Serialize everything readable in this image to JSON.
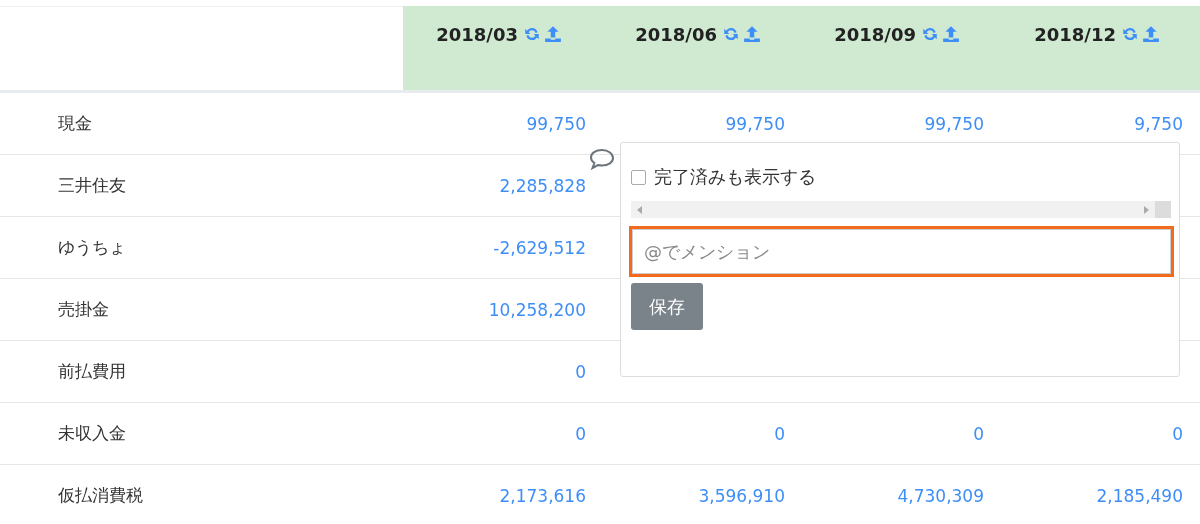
{
  "table": {
    "columns": [
      {
        "label": "2018/03"
      },
      {
        "label": "2018/06"
      },
      {
        "label": "2018/09"
      },
      {
        "label": "2018/12"
      }
    ],
    "rows": [
      {
        "label": "現金",
        "column_1": "99,750",
        "column_2": "99,750",
        "column_3": "99,750",
        "column_4": "9,750"
      },
      {
        "label": "三井住友",
        "column_1": "2,285,828"
      },
      {
        "label": "ゆうちょ",
        "column_1": "-2,629,512"
      },
      {
        "label": "売掛金",
        "column_1": "10,258,200"
      },
      {
        "label": "前払費用",
        "column_1": "0"
      },
      {
        "label": "未収入金",
        "column_1": "0",
        "column_2": "0",
        "column_3": "0",
        "column_4": "0"
      },
      {
        "label": "仮払消費税",
        "column_1": "2,173,616",
        "column_2": "3,596,910",
        "column_3": "4,730,309",
        "column_4": "2,185,490"
      }
    ]
  },
  "comment_popover": {
    "show_completed": {
      "label": "完了済みも表示する",
      "checked": false
    },
    "mention_field": {
      "placeholder": "@でメンション"
    },
    "save_button": "保存"
  }
}
